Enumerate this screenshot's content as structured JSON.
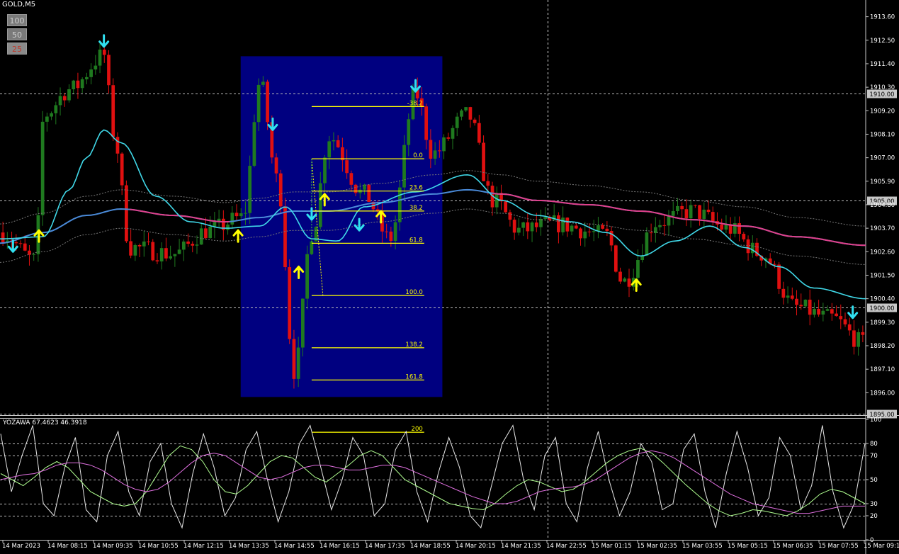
{
  "symbol_title": "GOLD,M5",
  "zoom_buttons": [
    "100",
    "50",
    "25"
  ],
  "indicator_title": "YOZAWA 67.4623 46.3918",
  "colors": {
    "background": "#000000",
    "bull": "#1f7a1f",
    "bear": "#e01010",
    "ma_fast": "#40d8e8",
    "ma_slow_blue": "#4a8ad8",
    "ma_slow_pink": "#e0408a",
    "fib": "#ffff00",
    "rect": "#000080",
    "arrow_up": "#ffff00",
    "arrow_down": "#30e0f0"
  },
  "chart_data": [
    {
      "type": "candlestick",
      "price_axis_labels": [
        "1913.60",
        "1912.50",
        "1911.40",
        "1910.30",
        "1909.20",
        "1908.10",
        "1907.00",
        "1905.90",
        "1904.80",
        "1903.70",
        "1902.60",
        "1901.50",
        "1900.40",
        "1899.30",
        "1898.20",
        "1897.10",
        "1896.00"
      ],
      "price_ticks": [
        1913.6,
        1912.5,
        1911.4,
        1910.3,
        1909.2,
        1908.1,
        1907.0,
        1905.9,
        1904.8,
        1903.7,
        1902.6,
        1901.5,
        1900.4,
        1899.3,
        1898.2,
        1897.1,
        1896.0
      ],
      "ylim": [
        1894.95,
        1914.25
      ],
      "level_labels": [
        "1910.00",
        "1905.00",
        "1900.00",
        "1895.00"
      ],
      "level_values": [
        1910.0,
        1905.0,
        1900.0,
        1895.0
      ],
      "x_labels": [
        "14 Mar 2023",
        "14 Mar 08:15",
        "14 Mar 09:35",
        "14 Mar 10:55",
        "14 Mar 12:15",
        "14 Mar 13:35",
        "14 Mar 14:55",
        "14 Mar 16:15",
        "14 Mar 17:35",
        "14 Mar 18:55",
        "14 Mar 20:15",
        "14 Mar 21:35",
        "14 Mar 22:55",
        "15 Mar 01:15",
        "15 Mar 02:35",
        "15 Mar 03:55",
        "15 Mar 05:15",
        "15 Mar 06:35",
        "15 Mar 07:55",
        "15 Mar 09:15"
      ],
      "fib_labels": [
        "-38.2",
        "0.0",
        "23.6",
        "38.2",
        "61.8",
        "100.0",
        "138.2",
        "161.8",
        "200"
      ],
      "fib_ratios": [
        -0.382,
        0.0,
        0.236,
        0.382,
        0.618,
        1.0,
        1.382,
        1.618,
        2.0
      ],
      "fib_range": {
        "p0": 1906.95,
        "p100": 1900.55
      },
      "close_path": [
        {
          "t": 0,
          "p": 1903.5
        },
        {
          "t": 0.04,
          "p": 1902.2
        },
        {
          "t": 0.05,
          "p": 1909.0
        },
        {
          "t": 0.08,
          "p": 1910.2
        },
        {
          "t": 0.12,
          "p": 1911.8
        },
        {
          "t": 0.13,
          "p": 1908.2
        },
        {
          "t": 0.15,
          "p": 1902.8
        },
        {
          "t": 0.2,
          "p": 1902.5
        },
        {
          "t": 0.24,
          "p": 1903.6
        },
        {
          "t": 0.28,
          "p": 1904.2
        },
        {
          "t": 0.3,
          "p": 1910.5
        },
        {
          "t": 0.32,
          "p": 1906.0
        },
        {
          "t": 0.34,
          "p": 1897.0
        },
        {
          "t": 0.36,
          "p": 1903.5
        },
        {
          "t": 0.38,
          "p": 1908.0
        },
        {
          "t": 0.42,
          "p": 1905.3
        },
        {
          "t": 0.45,
          "p": 1903.2
        },
        {
          "t": 0.48,
          "p": 1910.0
        },
        {
          "t": 0.5,
          "p": 1907.2
        },
        {
          "t": 0.54,
          "p": 1909.0
        },
        {
          "t": 0.57,
          "p": 1905.0
        },
        {
          "t": 0.6,
          "p": 1903.6
        },
        {
          "t": 0.64,
          "p": 1903.9
        },
        {
          "t": 0.7,
          "p": 1903.4
        },
        {
          "t": 0.72,
          "p": 1901.2
        },
        {
          "t": 0.76,
          "p": 1904.0
        },
        {
          "t": 0.8,
          "p": 1904.5
        },
        {
          "t": 0.84,
          "p": 1903.7
        },
        {
          "t": 0.88,
          "p": 1902.5
        },
        {
          "t": 0.92,
          "p": 1900.0
        },
        {
          "t": 0.96,
          "p": 1899.5
        },
        {
          "t": 1.0,
          "p": 1898.3
        }
      ],
      "ma_fast_points": [
        {
          "t": 0,
          "p": 1903.2
        },
        {
          "t": 0.05,
          "p": 1903.3
        },
        {
          "t": 0.08,
          "p": 1905.5
        },
        {
          "t": 0.1,
          "p": 1907.0
        },
        {
          "t": 0.12,
          "p": 1908.3
        },
        {
          "t": 0.14,
          "p": 1907.7
        },
        {
          "t": 0.18,
          "p": 1905.2
        },
        {
          "t": 0.22,
          "p": 1904.0
        },
        {
          "t": 0.26,
          "p": 1903.7
        },
        {
          "t": 0.3,
          "p": 1903.8
        },
        {
          "t": 0.33,
          "p": 1904.7
        },
        {
          "t": 0.36,
          "p": 1903.2
        },
        {
          "t": 0.39,
          "p": 1903.1
        },
        {
          "t": 0.42,
          "p": 1904.7
        },
        {
          "t": 0.48,
          "p": 1905.4
        },
        {
          "t": 0.54,
          "p": 1906.2
        },
        {
          "t": 0.58,
          "p": 1905.0
        },
        {
          "t": 0.62,
          "p": 1904.3
        },
        {
          "t": 0.66,
          "p": 1904.0
        },
        {
          "t": 0.7,
          "p": 1903.5
        },
        {
          "t": 0.74,
          "p": 1902.4
        },
        {
          "t": 0.78,
          "p": 1903.1
        },
        {
          "t": 0.82,
          "p": 1903.8
        },
        {
          "t": 0.86,
          "p": 1902.8
        },
        {
          "t": 0.9,
          "p": 1901.9
        },
        {
          "t": 0.94,
          "p": 1900.9
        },
        {
          "t": 1.0,
          "p": 1900.4
        }
      ],
      "ma_slow_points": [
        {
          "t": 0,
          "p": 1903.0
        },
        {
          "t": 0.05,
          "p": 1903.5
        },
        {
          "t": 0.1,
          "p": 1904.3
        },
        {
          "t": 0.14,
          "p": 1904.6
        },
        {
          "t": 0.2,
          "p": 1904.3
        },
        {
          "t": 0.26,
          "p": 1904.0
        },
        {
          "t": 0.3,
          "p": 1904.2
        },
        {
          "t": 0.34,
          "p": 1904.5
        },
        {
          "t": 0.38,
          "p": 1904.5
        },
        {
          "t": 0.44,
          "p": 1904.9
        },
        {
          "t": 0.5,
          "p": 1905.3
        },
        {
          "t": 0.54,
          "p": 1905.5
        },
        {
          "t": 0.58,
          "p": 1905.3
        },
        {
          "t": 0.62,
          "p": 1905.0
        },
        {
          "t": 0.68,
          "p": 1904.8
        },
        {
          "t": 0.74,
          "p": 1904.5
        },
        {
          "t": 0.8,
          "p": 1904.1
        },
        {
          "t": 0.86,
          "p": 1903.8
        },
        {
          "t": 0.92,
          "p": 1903.3
        },
        {
          "t": 1.0,
          "p": 1902.9
        }
      ],
      "arrows_up": [
        {
          "t": 0.045,
          "p": 1903.3
        },
        {
          "t": 0.275,
          "p": 1903.3
        },
        {
          "t": 0.345,
          "p": 1901.6
        },
        {
          "t": 0.375,
          "p": 1905.0
        },
        {
          "t": 0.44,
          "p": 1904.2
        },
        {
          "t": 0.735,
          "p": 1901.0
        }
      ],
      "arrows_down": [
        {
          "t": 0.015,
          "p": 1902.9
        },
        {
          "t": 0.12,
          "p": 1912.5
        },
        {
          "t": 0.315,
          "p": 1908.6
        },
        {
          "t": 0.36,
          "p": 1904.4
        },
        {
          "t": 0.415,
          "p": 1903.9
        },
        {
          "t": 0.48,
          "p": 1910.4
        },
        {
          "t": 0.985,
          "p": 1899.8
        }
      ]
    },
    {
      "type": "line",
      "ylim": [
        0,
        100
      ],
      "y_ticks": [
        0,
        20,
        30,
        50,
        70,
        80,
        100
      ],
      "y_tick_labels": [
        "0",
        "20",
        "30",
        "50",
        "70",
        "80",
        "100"
      ],
      "levels": [
        20,
        30,
        50,
        70,
        80
      ],
      "series": [
        {
          "color": "#e8e8e8",
          "values": [
            88,
            40,
            70,
            95,
            30,
            20,
            60,
            85,
            25,
            15,
            70,
            90,
            40,
            20,
            65,
            80,
            30,
            10,
            55,
            88,
            60,
            20,
            35,
            75,
            90,
            50,
            15,
            40,
            80,
            95,
            60,
            25,
            50,
            85,
            70,
            20,
            30,
            75,
            90,
            40,
            15,
            55,
            85,
            60,
            20,
            10,
            45,
            80,
            95,
            50,
            25,
            70,
            85,
            30,
            15,
            60,
            90,
            50,
            20,
            40,
            80,
            65,
            25,
            30,
            75,
            88,
            40,
            10,
            55,
            90,
            60,
            20,
            35,
            85,
            70,
            25,
            45,
            95,
            40,
            10,
            30,
            80
          ]
        },
        {
          "color": "#b0ff90",
          "values": [
            55,
            50,
            45,
            52,
            60,
            65,
            60,
            50,
            40,
            35,
            30,
            28,
            30,
            40,
            55,
            70,
            78,
            75,
            65,
            50,
            40,
            38,
            45,
            55,
            65,
            70,
            68,
            60,
            52,
            48,
            55,
            62,
            70,
            74,
            70,
            60,
            50,
            45,
            40,
            35,
            30,
            28,
            26,
            25,
            30,
            38,
            45,
            50,
            48,
            44,
            40,
            42,
            48,
            56,
            64,
            70,
            74,
            76,
            72,
            64,
            55,
            46,
            38,
            30,
            24,
            20,
            22,
            25,
            24,
            22,
            20,
            24,
            30,
            38,
            42,
            40,
            35,
            30
          ]
        },
        {
          "color": "#e070e0",
          "values": [
            50,
            52,
            54,
            55,
            58,
            62,
            64,
            64,
            62,
            58,
            52,
            46,
            42,
            40,
            42,
            48,
            56,
            64,
            70,
            72,
            70,
            64,
            58,
            52,
            50,
            52,
            56,
            60,
            62,
            62,
            60,
            58,
            58,
            60,
            62,
            62,
            60,
            56,
            52,
            48,
            44,
            40,
            36,
            33,
            30,
            30,
            32,
            36,
            40,
            42,
            43,
            44,
            46,
            50,
            56,
            62,
            68,
            72,
            74,
            72,
            68,
            62,
            56,
            50,
            44,
            38,
            34,
            30,
            28,
            26,
            24,
            22,
            22,
            24,
            26,
            28,
            28,
            28
          ]
        }
      ]
    }
  ]
}
